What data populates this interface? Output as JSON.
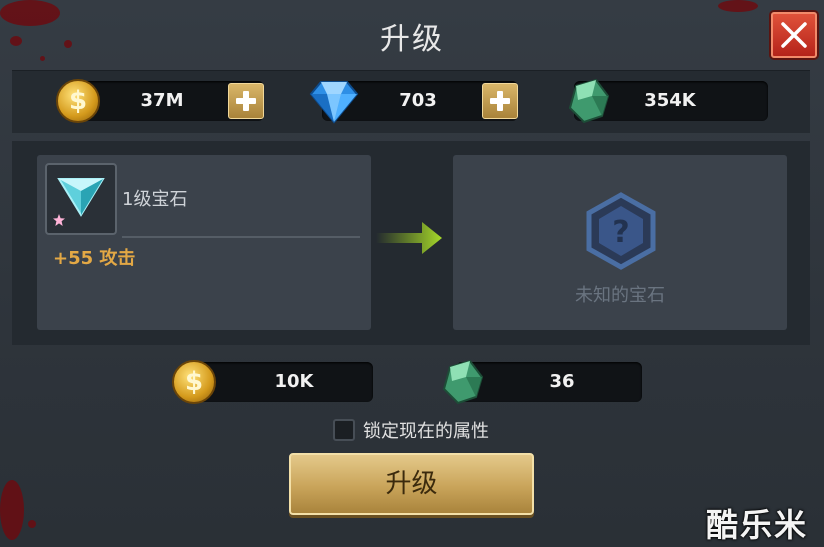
{
  "header": {
    "title": "升级"
  },
  "resources": [
    {
      "icon": "gold-coin-icon",
      "value": "37M",
      "has_plus": true
    },
    {
      "icon": "diamond-icon",
      "value": "703",
      "has_plus": true
    },
    {
      "icon": "green-stone-icon",
      "value": "354K",
      "has_plus": false
    }
  ],
  "current_gem": {
    "name": "1级宝石",
    "stat": "+55 攻击"
  },
  "result_gem": {
    "name": "未知的宝石"
  },
  "costs": [
    {
      "icon": "gold-coin-icon",
      "value": "10K"
    },
    {
      "icon": "green-stone-icon",
      "value": "36"
    }
  ],
  "lock_option": {
    "label": "锁定现在的属性",
    "checked": false
  },
  "upgrade_button": {
    "label": "升级"
  },
  "watermark": "酷乐米",
  "colors": {
    "accent_gold": "#e3a845",
    "close_red": "#c8321f",
    "arrow_green": "#9acb1e"
  }
}
